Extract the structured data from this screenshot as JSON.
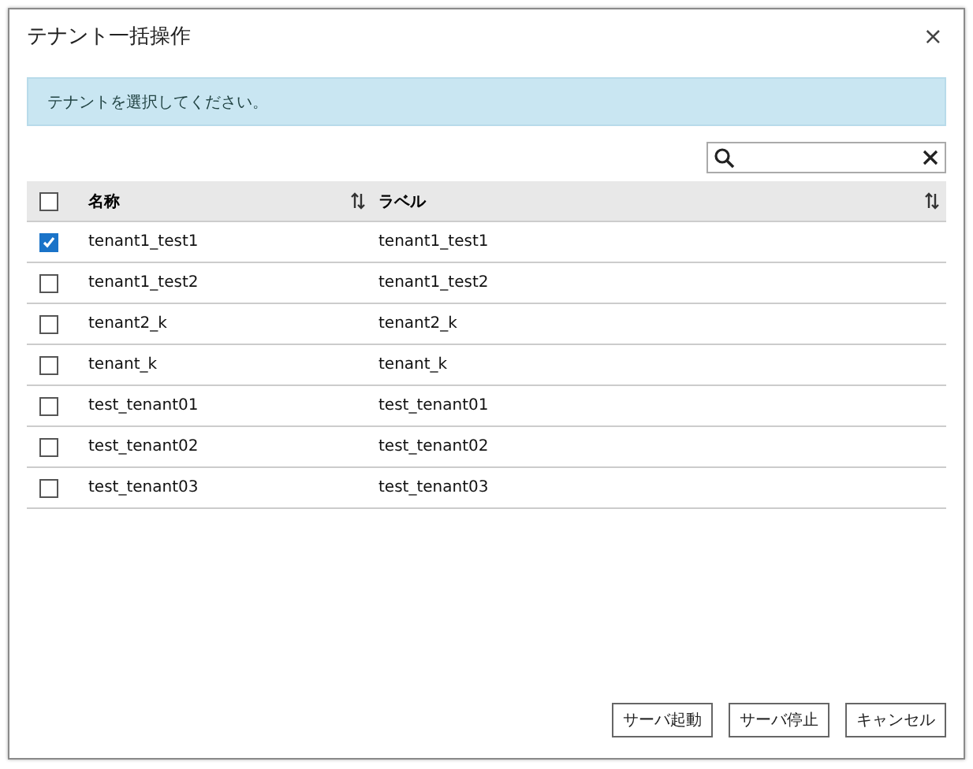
{
  "dialog": {
    "title": "テナント一括操作",
    "close": "×"
  },
  "info": "テナントを選択してください。",
  "table": {
    "select_all": {
      "checked": false
    },
    "columns": [
      "名称",
      "ラベル"
    ],
    "rows": [
      {
        "name": "tenant1_test1",
        "label": "tenant1_test1",
        "checked": true
      },
      {
        "name": "tenant1_test2",
        "label": "tenant1_test2",
        "checked": false
      },
      {
        "name": "tenant2_k",
        "label": "tenant2_k",
        "checked": false
      },
      {
        "name": "tenant_k",
        "label": "tenant_k",
        "checked": false
      },
      {
        "name": "test_tenant01",
        "label": "test_tenant01",
        "checked": false
      },
      {
        "name": "test_tenant02",
        "label": "test_tenant02",
        "checked": false
      },
      {
        "name": "test_tenant03",
        "label": "test_tenant03",
        "checked": false
      }
    ]
  },
  "buttons": [
    "サーバ起動",
    "サーバ停止",
    "キャンセル"
  ]
}
